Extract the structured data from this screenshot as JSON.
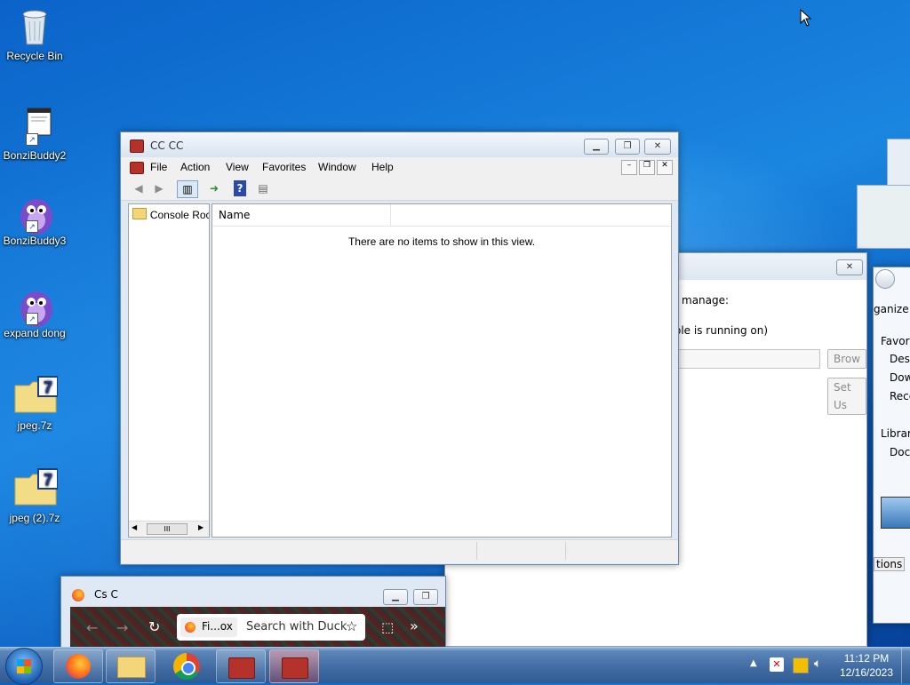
{
  "desktop": {
    "icons": [
      {
        "label": "Recycle Bin",
        "icon": "recycle-bin-icon"
      },
      {
        "label": "BonziBuddy2",
        "icon": "window-shortcut-icon"
      },
      {
        "label": "BonziBuddy3",
        "icon": "bonzi-icon"
      },
      {
        "label": "expand dong",
        "icon": "bonzi-icon"
      },
      {
        "label": "jpeg.7z",
        "icon": "7z-archive-icon"
      },
      {
        "label": "jpeg (2).7z",
        "icon": "7z-archive-icon"
      }
    ]
  },
  "mmc": {
    "title": "CC CC",
    "menu": [
      "File",
      "Action",
      "View",
      "Favorites",
      "Window",
      "Help"
    ],
    "tree_root": "Console Roc",
    "column_name": "Name",
    "empty_message": "There are no items to show in this view.",
    "scroll_thumb": "III"
  },
  "bg_dialog": {
    "manage_text": "manage:",
    "running_text": "ole is running on)",
    "browse_label": "Brow",
    "setup_label": "Set Us"
  },
  "explorer": {
    "organize_label": "ganize",
    "favorites_label": "Favori",
    "items": [
      "Desk",
      "Dow",
      "Rece"
    ],
    "libraries_label": "Librari",
    "docs_label": "Docu",
    "tab_label": "tions"
  },
  "firefox": {
    "title": "Cs C",
    "tab_label": "Fi...ox",
    "search_placeholder": "Search with Duck"
  },
  "taskbar": {
    "time": "11:12 PM",
    "date": "12/16/2023"
  },
  "colors": {
    "accent": "#1a86e0",
    "taskbar": "#3e6aa2"
  }
}
